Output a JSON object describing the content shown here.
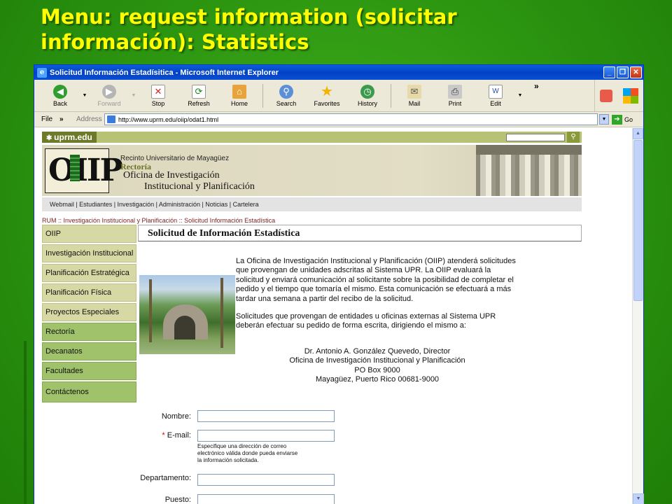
{
  "slide": {
    "title_line1": "Menu: request information (solicitar",
    "title_line2": "información): Statistics"
  },
  "browser": {
    "window_title": "Solicitud Información Estadísitica - Microsoft Internet Explorer",
    "toolbar": {
      "back": "Back",
      "forward": "Forward",
      "stop": "Stop",
      "refresh": "Refresh",
      "home": "Home",
      "search": "Search",
      "favorites": "Favorites",
      "history": "History",
      "mail": "Mail",
      "print": "Print",
      "edit": "Edit",
      "chevron": "»"
    },
    "menu_file": "File",
    "menu_chevron": "»",
    "address_label": "Address",
    "url": "http://www.uprm.edu/oiip/odat1.html",
    "go_label": "Go"
  },
  "site": {
    "logo_text": "uprm.edu",
    "banner": {
      "logo": "OIIP",
      "line1": "Recinto Universitario de Mayagüez",
      "line2": "Rectoría",
      "line3": "Oficina de Investigación",
      "line4": "Institucional y Planificación"
    },
    "topnav": "Webmail | Estudiantes | Investigación | Administración | Noticias | Cartelera",
    "breadcrumb": "RUM :: Investigación Institucional y Planificación :: Solicitud Información Estadística",
    "sidenav": [
      "OIIP",
      "Investigación Institucional",
      "Planificación Estratégica",
      "Planificación Física",
      "Proyectos Especiales",
      "Rectoría",
      "Decanatos",
      "Facultades",
      "Contáctenos"
    ],
    "heading": "Solicitud de Información Estadística",
    "para1": [
      "La Oficina de Investigación Institucional y Planificación (OIIP) atenderá solicitudes",
      "que provengan de unidades adscritas al Sistema UPR. La OIIP evaluará la",
      "solicitud y enviará comunicación al solicitante sobre la posibilidad de completar el",
      "pedido y el tiempo que tomaría el mismo. Esta comunicación se efectuará a más",
      "tardar una semana a partir del recibo de la solicitud."
    ],
    "para2": [
      "Solicitudes que provengan de entidades u oficinas externas al Sistema UPR",
      "deberán efectuar su pedido de forma escrita, dirigiendo el mismo a:"
    ],
    "address": [
      "Dr. Antonio A. González Quevedo, Director",
      "Oficina de Investigación Institucional y Planificación",
      "PO Box 9000",
      "Mayagüez, Puerto Rico 00681-9000"
    ],
    "form": {
      "nombre_label": "Nombre:",
      "email_required": "*",
      "email_label": "E-mail:",
      "email_hint": [
        "Especifique una dirección de correo",
        "electrónico válida donde pueda enviarse",
        "la información solicitada."
      ],
      "departamento_label": "Departamento:",
      "puesto_label": "Puesto:"
    }
  }
}
